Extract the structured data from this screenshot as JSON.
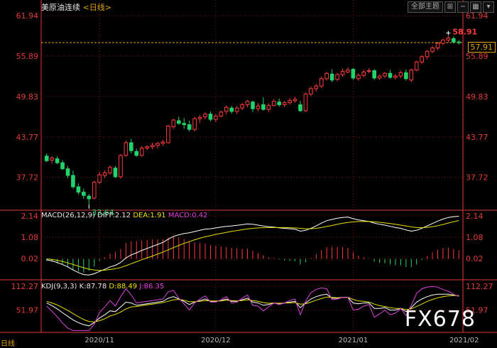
{
  "header": {
    "instrument": "美原油连续",
    "period_label": "<日线>",
    "toolbar": {
      "theme_label": "全部主题",
      "icons": [
        "zoom-in-icon",
        "minus-icon",
        "grid-icon",
        "arrow-down-icon"
      ]
    }
  },
  "price_tag": "57.91",
  "footer": {
    "period_badge": "日线"
  },
  "watermark": "FX678",
  "macd": {
    "title": "MACD(26,12,9)",
    "diff_label": "DIFF:2.12",
    "dea_label": "DEA:1.91",
    "macd_label": "MACD:0.42"
  },
  "kdj": {
    "title": "KDJ(9,3,3)",
    "k_label": "K:87.78",
    "d_label": "D:88.49",
    "j_label": "J:86.35"
  },
  "colors": {
    "up": "#ff3b3b",
    "down": "#22d36b",
    "diff": "#ffffff",
    "dea": "#e8e000",
    "j": "#e040e0",
    "axis": "#e23a3a",
    "grid": "#7a1a1a",
    "ref_line": "#e2a500"
  },
  "chart_data": [
    {
      "type": "candlestick",
      "ylim": [
        33.0,
        62.8
      ],
      "yticks": [
        "61.94",
        "55.89",
        "49.83",
        "43.77",
        "37.72"
      ],
      "ytick_values": [
        61.94,
        55.89,
        49.83,
        43.77,
        37.72
      ],
      "x_labels": [
        "2020/11",
        "2020/12",
        "2021/01",
        "2021/02"
      ],
      "x_label_index": [
        10,
        32,
        58,
        79
      ],
      "annotations": {
        "high_label": "58.91",
        "low_label": "33.64",
        "ref_line": 57.91
      },
      "candles": [
        [
          40.9,
          41.3,
          40.0,
          40.2
        ],
        [
          40.3,
          40.9,
          39.8,
          40.6
        ],
        [
          40.5,
          40.9,
          39.7,
          39.9
        ],
        [
          39.9,
          40.3,
          38.8,
          39.0
        ],
        [
          39.0,
          39.4,
          37.6,
          38.0
        ],
        [
          38.0,
          38.7,
          36.0,
          36.3
        ],
        [
          36.3,
          36.8,
          35.1,
          35.5
        ],
        [
          35.5,
          36.0,
          34.5,
          35.0
        ],
        [
          34.9,
          35.2,
          33.64,
          34.5
        ],
        [
          34.6,
          37.2,
          34.4,
          37.0
        ],
        [
          37.0,
          38.5,
          36.7,
          38.1
        ],
        [
          38.0,
          38.8,
          37.6,
          38.4
        ],
        [
          38.4,
          39.5,
          38.1,
          39.2
        ],
        [
          39.1,
          39.4,
          37.6,
          37.8
        ],
        [
          37.8,
          41.2,
          37.5,
          41.0
        ],
        [
          41.0,
          43.2,
          40.8,
          42.9
        ],
        [
          42.9,
          43.5,
          41.3,
          41.7
        ],
        [
          41.6,
          42.0,
          40.8,
          41.0
        ],
        [
          41.0,
          42.4,
          40.8,
          42.1
        ],
        [
          42.1,
          42.5,
          41.8,
          42.3
        ],
        [
          42.3,
          42.9,
          41.9,
          42.5
        ],
        [
          42.5,
          43.0,
          42.0,
          42.8
        ],
        [
          42.8,
          43.3,
          42.5,
          43.0
        ],
        [
          42.9,
          45.6,
          42.8,
          45.4
        ],
        [
          45.3,
          46.5,
          45.0,
          46.3
        ],
        [
          46.2,
          46.8,
          45.6,
          45.8
        ],
        [
          45.8,
          46.6,
          45.0,
          45.6
        ],
        [
          45.6,
          46.2,
          44.6,
          44.9
        ],
        [
          44.9,
          46.8,
          44.6,
          46.5
        ],
        [
          46.5,
          47.0,
          45.9,
          46.7
        ],
        [
          46.8,
          47.5,
          46.4,
          47.2
        ],
        [
          47.2,
          47.6,
          46.1,
          46.4
        ],
        [
          46.4,
          47.2,
          46.0,
          46.9
        ],
        [
          46.9,
          47.7,
          46.7,
          47.5
        ],
        [
          47.6,
          48.5,
          47.2,
          48.2
        ],
        [
          48.1,
          48.4,
          47.3,
          47.6
        ],
        [
          47.6,
          48.4,
          47.2,
          48.1
        ],
        [
          48.1,
          48.9,
          47.8,
          48.6
        ],
        [
          48.6,
          49.3,
          48.2,
          49.1
        ],
        [
          49.0,
          49.2,
          47.5,
          48.0
        ],
        [
          48.0,
          48.8,
          47.6,
          48.4
        ],
        [
          48.6,
          49.7,
          47.7,
          47.9
        ],
        [
          47.9,
          48.8,
          47.5,
          48.5
        ],
        [
          48.5,
          49.4,
          48.3,
          49.1
        ],
        [
          49.0,
          49.5,
          48.3,
          48.6
        ],
        [
          48.6,
          49.2,
          48.3,
          48.9
        ],
        [
          48.9,
          49.6,
          48.6,
          49.2
        ],
        [
          49.2,
          49.8,
          48.9,
          49.4
        ],
        [
          48.6,
          49.2,
          47.5,
          47.7
        ],
        [
          47.7,
          50.4,
          47.5,
          50.2
        ],
        [
          50.2,
          51.3,
          49.9,
          51.0
        ],
        [
          51.0,
          51.7,
          50.6,
          51.4
        ],
        [
          51.4,
          52.8,
          51.1,
          52.5
        ],
        [
          52.5,
          53.5,
          52.2,
          53.3
        ],
        [
          53.2,
          53.9,
          52.0,
          52.3
        ],
        [
          52.4,
          53.4,
          52.1,
          53.1
        ],
        [
          53.1,
          54.0,
          52.8,
          53.6
        ],
        [
          53.5,
          54.2,
          53.3,
          53.8
        ],
        [
          53.9,
          54.1,
          52.3,
          52.6
        ],
        [
          52.5,
          53.3,
          52.2,
          53.0
        ],
        [
          53.0,
          53.8,
          52.7,
          53.5
        ],
        [
          53.6,
          54.1,
          53.3,
          53.7
        ],
        [
          53.7,
          53.9,
          52.3,
          52.6
        ],
        [
          52.6,
          53.1,
          52.3,
          52.9
        ],
        [
          52.9,
          53.5,
          52.6,
          53.3
        ],
        [
          53.3,
          53.8,
          52.5,
          52.7
        ],
        [
          52.7,
          53.2,
          52.4,
          52.9
        ],
        [
          52.9,
          53.7,
          52.6,
          53.4
        ],
        [
          53.4,
          53.9,
          52.2,
          52.5
        ],
        [
          52.3,
          54.0,
          52.0,
          53.8
        ],
        [
          53.8,
          55.2,
          53.6,
          55.0
        ],
        [
          55.0,
          56.0,
          54.7,
          55.8
        ],
        [
          55.8,
          56.8,
          55.4,
          56.6
        ],
        [
          56.6,
          57.4,
          56.3,
          57.1
        ],
        [
          57.1,
          58.0,
          56.8,
          57.8
        ],
        [
          57.8,
          58.5,
          57.5,
          58.3
        ],
        [
          58.3,
          58.91,
          57.9,
          58.6
        ],
        [
          58.5,
          58.8,
          57.8,
          58.0
        ],
        [
          58.0,
          58.3,
          57.6,
          57.91
        ]
      ]
    },
    {
      "type": "line+bar",
      "title": "MACD(26,12,9)",
      "ylim": [
        -0.9,
        2.35
      ],
      "yticks": [
        "2.14",
        "1.08",
        "0.02"
      ],
      "ytick_values": [
        2.14,
        1.08,
        0.02
      ],
      "diff": [
        -0.05,
        -0.1,
        -0.18,
        -0.28,
        -0.4,
        -0.55,
        -0.68,
        -0.78,
        -0.8,
        -0.74,
        -0.62,
        -0.52,
        -0.4,
        -0.32,
        -0.18,
        0.05,
        0.2,
        0.3,
        0.42,
        0.52,
        0.62,
        0.72,
        0.82,
        0.98,
        1.12,
        1.2,
        1.26,
        1.3,
        1.36,
        1.42,
        1.48,
        1.5,
        1.54,
        1.58,
        1.62,
        1.64,
        1.67,
        1.7,
        1.74,
        1.72,
        1.68,
        1.64,
        1.6,
        1.58,
        1.54,
        1.52,
        1.5,
        1.48,
        1.38,
        1.42,
        1.52,
        1.64,
        1.78,
        1.9,
        1.96,
        2.02,
        2.06,
        2.08,
        2.0,
        1.94,
        1.9,
        1.86,
        1.78,
        1.72,
        1.68,
        1.62,
        1.56,
        1.52,
        1.44,
        1.38,
        1.42,
        1.52,
        1.64,
        1.76,
        1.88,
        1.98,
        2.06,
        2.1,
        2.12
      ],
      "dea": [
        0.0,
        -0.03,
        -0.07,
        -0.13,
        -0.2,
        -0.28,
        -0.36,
        -0.44,
        -0.51,
        -0.55,
        -0.57,
        -0.56,
        -0.53,
        -0.49,
        -0.43,
        -0.34,
        -0.24,
        -0.14,
        -0.04,
        0.05,
        0.14,
        0.24,
        0.34,
        0.45,
        0.56,
        0.67,
        0.77,
        0.86,
        0.95,
        1.03,
        1.1,
        1.16,
        1.22,
        1.27,
        1.32,
        1.37,
        1.41,
        1.45,
        1.49,
        1.52,
        1.54,
        1.55,
        1.56,
        1.56,
        1.56,
        1.56,
        1.55,
        1.54,
        1.52,
        1.5,
        1.5,
        1.52,
        1.56,
        1.61,
        1.66,
        1.72,
        1.77,
        1.81,
        1.84,
        1.86,
        1.86,
        1.86,
        1.85,
        1.82,
        1.79,
        1.76,
        1.72,
        1.68,
        1.64,
        1.59,
        1.56,
        1.55,
        1.57,
        1.6,
        1.65,
        1.71,
        1.78,
        1.85,
        1.91
      ],
      "macd": [
        -0.1,
        -0.14,
        -0.22,
        -0.3,
        -0.4,
        -0.54,
        -0.64,
        -0.68,
        -0.58,
        -0.38,
        -0.1,
        0.08,
        0.26,
        0.34,
        0.5,
        0.78,
        0.88,
        0.88,
        0.92,
        0.94,
        0.96,
        0.96,
        0.96,
        1.06,
        1.12,
        1.06,
        0.98,
        0.88,
        0.82,
        0.78,
        0.76,
        0.68,
        0.64,
        0.62,
        0.6,
        0.54,
        0.52,
        0.5,
        0.5,
        0.4,
        0.28,
        0.18,
        0.08,
        0.04,
        -0.04,
        -0.08,
        -0.1,
        -0.12,
        -0.28,
        -0.16,
        0.04,
        0.24,
        0.44,
        0.58,
        0.6,
        0.6,
        0.58,
        0.54,
        0.32,
        0.16,
        0.08,
        0.0,
        -0.14,
        -0.2,
        -0.22,
        -0.28,
        -0.32,
        -0.32,
        -0.4,
        -0.42,
        -0.28,
        -0.06,
        0.14,
        0.32,
        0.46,
        0.54,
        0.56,
        0.5,
        0.42
      ]
    },
    {
      "type": "line",
      "title": "KDJ(9,3,3)",
      "ylim": [
        8,
        125
      ],
      "yticks": [
        "112.27",
        "51.97"
      ],
      "ytick_values": [
        112.27,
        51.97
      ],
      "k": [
        70,
        63,
        55,
        45,
        36,
        27,
        20,
        15,
        12,
        20,
        32,
        40,
        50,
        48,
        60,
        72,
        70,
        64,
        66,
        68,
        70,
        72,
        74,
        82,
        86,
        80,
        74,
        66,
        72,
        76,
        80,
        74,
        74,
        76,
        80,
        74,
        74,
        78,
        82,
        72,
        70,
        64,
        66,
        70,
        68,
        70,
        72,
        74,
        58,
        70,
        80,
        86,
        90,
        92,
        82,
        82,
        84,
        84,
        70,
        68,
        70,
        70,
        56,
        56,
        58,
        52,
        52,
        56,
        48,
        58,
        72,
        80,
        86,
        90,
        92,
        92,
        92,
        90,
        87.78
      ],
      "d": [
        74,
        70,
        65,
        58,
        51,
        43,
        35,
        28,
        23,
        22,
        25,
        30,
        37,
        41,
        47,
        55,
        60,
        61,
        63,
        65,
        67,
        69,
        71,
        74,
        78,
        79,
        77,
        73,
        73,
        74,
        76,
        75,
        75,
        75,
        77,
        76,
        75,
        76,
        78,
        76,
        74,
        71,
        69,
        70,
        69,
        70,
        70,
        71,
        67,
        68,
        72,
        77,
        81,
        85,
        84,
        83,
        84,
        84,
        79,
        75,
        74,
        72,
        67,
        63,
        61,
        58,
        56,
        56,
        53,
        55,
        61,
        67,
        74,
        79,
        83,
        86,
        88,
        89,
        88.49
      ],
      "j": [
        62,
        49,
        35,
        19,
        6,
        0,
        0,
        0,
        0,
        16,
        46,
        60,
        76,
        62,
        86,
        106,
        90,
        70,
        72,
        74,
        76,
        78,
        80,
        98,
        102,
        82,
        68,
        52,
        70,
        80,
        88,
        72,
        72,
        78,
        86,
        70,
        72,
        82,
        90,
        64,
        62,
        50,
        60,
        70,
        66,
        70,
        76,
        80,
        40,
        74,
        96,
        104,
        108,
        106,
        78,
        80,
        84,
        84,
        52,
        54,
        62,
        66,
        34,
        42,
        52,
        40,
        44,
        56,
        38,
        64,
        94,
        106,
        110,
        112,
        110,
        104,
        100,
        92,
        86.35
      ]
    }
  ]
}
